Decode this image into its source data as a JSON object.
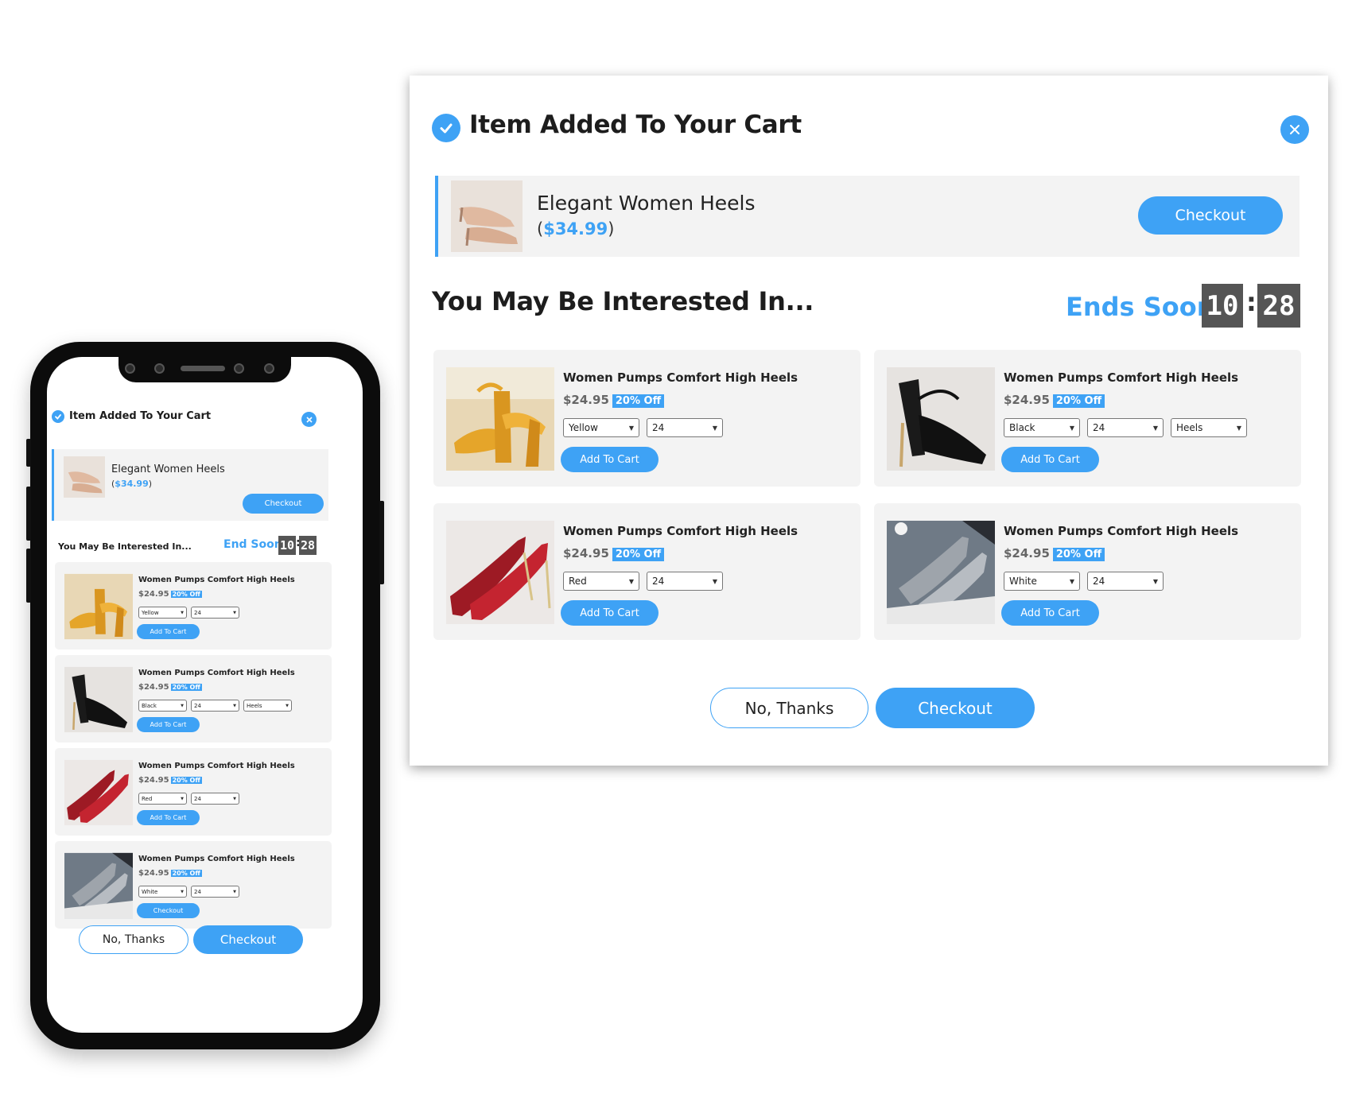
{
  "colors": {
    "accent": "#3ea2f5",
    "panel": "#f3f3f3",
    "timer_bg": "#555555"
  },
  "desktop": {
    "title": "Item Added To Your Cart",
    "added_item": {
      "name": "Elegant Women Heels",
      "price": "$34.99",
      "checkout_label": "Checkout"
    },
    "interest_title": "You May Be Interested In...",
    "ends_label": "Ends Soon:",
    "timer": {
      "minutes": "10",
      "separator": ":",
      "seconds": "28"
    },
    "products": [
      {
        "name": "Women Pumps Comfort High Heels",
        "price": "$24.95",
        "badge": "20% Off",
        "selects": [
          "Yellow",
          "24"
        ],
        "button": "Add To Cart",
        "image": "yellow-heel-image"
      },
      {
        "name": "Women Pumps Comfort High Heels",
        "price": "$24.95",
        "badge": "20% Off",
        "selects": [
          "Black",
          "24",
          "Heels"
        ],
        "button": "Add To Cart",
        "image": "black-heel-image"
      },
      {
        "name": "Women Pumps Comfort High Heels",
        "price": "$24.95",
        "badge": "20% Off",
        "selects": [
          "Red",
          "24"
        ],
        "button": "Add To Cart",
        "image": "red-heel-image"
      },
      {
        "name": "Women Pumps Comfort High Heels",
        "price": "$24.95",
        "badge": "20% Off",
        "selects": [
          "White",
          "24"
        ],
        "button": "Add To Cart",
        "image": "glitter-heel-image"
      }
    ],
    "no_thanks_label": "No, Thanks",
    "checkout_label": "Checkout"
  },
  "mobile": {
    "title": "Item Added To Your Cart",
    "added_item": {
      "name": "Elegant Women Heels",
      "price": "$34.99",
      "checkout_label": "Checkout"
    },
    "interest_title": "You May Be Interested In...",
    "ends_label": "End Soon",
    "timer": {
      "minutes": "10",
      "separator": ":",
      "seconds": "28"
    },
    "products": [
      {
        "name": "Women Pumps Comfort High Heels",
        "price": "$24.95",
        "badge": "20% Off",
        "selects": [
          "Yellow",
          "24"
        ],
        "button": "Add To Cart"
      },
      {
        "name": "Women Pumps Comfort High Heels",
        "price": "$24.95",
        "badge": "20% Off",
        "selects": [
          "Black",
          "24",
          "Heels"
        ],
        "button": "Add To Cart"
      },
      {
        "name": "Women Pumps Comfort High Heels",
        "price": "$24.95",
        "badge": "20% Off",
        "selects": [
          "Red",
          "24"
        ],
        "button": "Add To Cart"
      },
      {
        "name": "Women Pumps Comfort High Heels",
        "price": "$24.95",
        "badge": "20% Off",
        "selects": [
          "White",
          "24"
        ],
        "button": "Checkout"
      }
    ],
    "no_thanks_label": "No, Thanks",
    "checkout_label": "Checkout"
  }
}
